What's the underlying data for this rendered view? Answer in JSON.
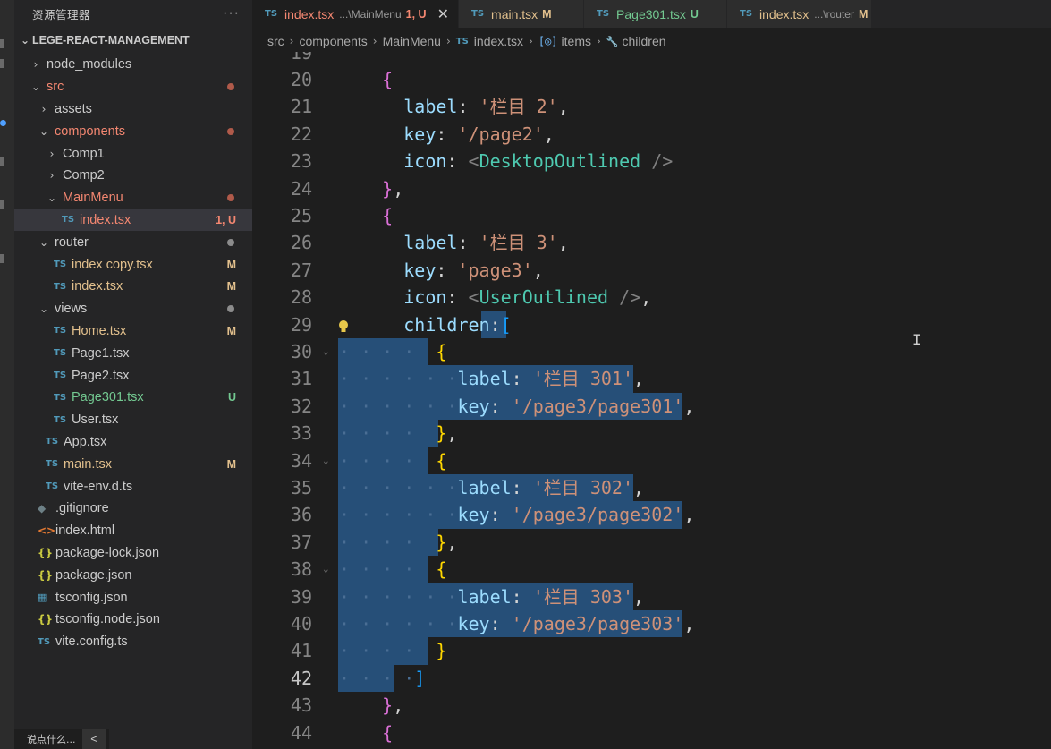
{
  "explorer": {
    "title": "资源管理器",
    "more": "···",
    "project": "LEGE-REACT-MANAGEMENT",
    "items": [
      {
        "label": "node_modules",
        "kind": "folder",
        "depth": 1,
        "expanded": false,
        "color": "default",
        "status": ""
      },
      {
        "label": "src",
        "kind": "folder",
        "depth": 1,
        "expanded": true,
        "color": "err",
        "status": "dot-err"
      },
      {
        "label": "assets",
        "kind": "folder",
        "depth": 2,
        "expanded": false,
        "color": "default",
        "status": ""
      },
      {
        "label": "components",
        "kind": "folder",
        "depth": 2,
        "expanded": true,
        "color": "err",
        "status": "dot-err"
      },
      {
        "label": "Comp1",
        "kind": "folder",
        "depth": 3,
        "expanded": false,
        "color": "default",
        "status": ""
      },
      {
        "label": "Comp2",
        "kind": "folder",
        "depth": 3,
        "expanded": false,
        "color": "default",
        "status": ""
      },
      {
        "label": "MainMenu",
        "kind": "folder",
        "depth": 3,
        "expanded": true,
        "color": "err",
        "status": "dot-err"
      },
      {
        "label": "index.tsx",
        "kind": "ts",
        "depth": 4,
        "color": "err",
        "status": "1, U",
        "selected": true
      },
      {
        "label": "router",
        "kind": "folder",
        "depth": 2,
        "expanded": true,
        "color": "default",
        "status": "dot-gray"
      },
      {
        "label": "index copy.tsx",
        "kind": "ts",
        "depth": 3,
        "color": "mod",
        "status": "M"
      },
      {
        "label": "index.tsx",
        "kind": "ts",
        "depth": 3,
        "color": "mod",
        "status": "M"
      },
      {
        "label": "views",
        "kind": "folder",
        "depth": 2,
        "expanded": true,
        "color": "default",
        "status": "dot-gray"
      },
      {
        "label": "Home.tsx",
        "kind": "ts",
        "depth": 3,
        "color": "mod",
        "status": "M"
      },
      {
        "label": "Page1.tsx",
        "kind": "ts",
        "depth": 3,
        "color": "default",
        "status": ""
      },
      {
        "label": "Page2.tsx",
        "kind": "ts",
        "depth": 3,
        "color": "default",
        "status": ""
      },
      {
        "label": "Page301.tsx",
        "kind": "ts",
        "depth": 3,
        "color": "untr",
        "status": "U"
      },
      {
        "label": "User.tsx",
        "kind": "ts",
        "depth": 3,
        "color": "default",
        "status": ""
      },
      {
        "label": "App.tsx",
        "kind": "ts",
        "depth": 2,
        "color": "default",
        "status": ""
      },
      {
        "label": "main.tsx",
        "kind": "ts",
        "depth": 2,
        "color": "mod",
        "status": "M"
      },
      {
        "label": "vite-env.d.ts",
        "kind": "ts",
        "depth": 2,
        "color": "default",
        "status": ""
      },
      {
        "label": ".gitignore",
        "kind": "git",
        "depth": 1,
        "color": "default",
        "status": ""
      },
      {
        "label": "index.html",
        "kind": "html",
        "depth": 1,
        "color": "default",
        "status": ""
      },
      {
        "label": "package-lock.json",
        "kind": "json",
        "depth": 1,
        "color": "default",
        "status": ""
      },
      {
        "label": "package.json",
        "kind": "json",
        "depth": 1,
        "color": "default",
        "status": ""
      },
      {
        "label": "tsconfig.json",
        "kind": "tsconf",
        "depth": 1,
        "color": "default",
        "status": ""
      },
      {
        "label": "tsconfig.node.json",
        "kind": "json",
        "depth": 1,
        "color": "default",
        "status": ""
      },
      {
        "label": "vite.config.ts",
        "kind": "ts",
        "depth": 1,
        "color": "default",
        "status": ""
      }
    ]
  },
  "statusbar": {
    "comment": "说点什么...",
    "back": "<"
  },
  "tabs": [
    {
      "icon": "TS",
      "name": "index.tsx",
      "desc": "...\\MainMenu",
      "status": "1, U",
      "color": "err",
      "active": true,
      "close": "✕"
    },
    {
      "icon": "TS",
      "name": "main.tsx",
      "desc": "",
      "status": "M",
      "color": "mod",
      "active": false
    },
    {
      "icon": "TS",
      "name": "Page301.tsx",
      "desc": "",
      "status": "U",
      "color": "untr",
      "active": false
    },
    {
      "icon": "TS",
      "name": "index.tsx",
      "desc": "...\\router",
      "status": "M",
      "color": "mod",
      "active": false
    }
  ],
  "breadcrumb": {
    "parts": [
      "src",
      "components",
      "MainMenu",
      "index.tsx",
      "items",
      "children"
    ],
    "ts_icon": "TS",
    "symbol_icon": "[◎]",
    "wrench_icon": "🔧"
  },
  "code": {
    "first_partial": "19",
    "lines": [
      {
        "n": "20",
        "segs": [
          [
            "p",
            "    "
          ],
          [
            "b2",
            "{"
          ]
        ]
      },
      {
        "n": "21",
        "segs": [
          [
            "p",
            "      "
          ],
          [
            "k",
            "label"
          ],
          [
            "p",
            ": "
          ],
          [
            "s",
            "'栏目 2'"
          ],
          [
            "p",
            ","
          ]
        ]
      },
      {
        "n": "22",
        "segs": [
          [
            "p",
            "      "
          ],
          [
            "k",
            "key"
          ],
          [
            "p",
            ": "
          ],
          [
            "s",
            "'/page2'"
          ],
          [
            "p",
            ","
          ]
        ]
      },
      {
        "n": "23",
        "segs": [
          [
            "p",
            "      "
          ],
          [
            "k",
            "icon"
          ],
          [
            "p",
            ": "
          ],
          [
            "tag",
            "<"
          ],
          [
            "cmp",
            "DesktopOutlined"
          ],
          [
            "p",
            " "
          ],
          [
            "tag",
            "/>"
          ]
        ]
      },
      {
        "n": "24",
        "segs": [
          [
            "p",
            "    "
          ],
          [
            "b2",
            "}"
          ],
          [
            "p",
            ","
          ]
        ]
      },
      {
        "n": "25",
        "segs": [
          [
            "p",
            "    "
          ],
          [
            "b2",
            "{"
          ]
        ]
      },
      {
        "n": "26",
        "segs": [
          [
            "p",
            "      "
          ],
          [
            "k",
            "label"
          ],
          [
            "p",
            ": "
          ],
          [
            "s",
            "'栏目 3'"
          ],
          [
            "p",
            ","
          ]
        ]
      },
      {
        "n": "27",
        "segs": [
          [
            "p",
            "      "
          ],
          [
            "k",
            "key"
          ],
          [
            "p",
            ": "
          ],
          [
            "s",
            "'page3'"
          ],
          [
            "p",
            ","
          ]
        ]
      },
      {
        "n": "28",
        "segs": [
          [
            "p",
            "      "
          ],
          [
            "k",
            "icon"
          ],
          [
            "p",
            ": "
          ],
          [
            "tag",
            "<"
          ],
          [
            "cmp",
            "UserOutlined"
          ],
          [
            "p",
            " "
          ],
          [
            "tag",
            "/>"
          ],
          [
            "p",
            ","
          ]
        ]
      },
      {
        "n": "29",
        "segs": [
          [
            "p",
            "      "
          ],
          [
            "k",
            "children"
          ],
          [
            "p",
            ":"
          ],
          [
            "b3",
            "["
          ]
        ]
      },
      {
        "n": "30",
        "segs": [
          [
            "ws",
            "· · · ·"
          ],
          [
            "p",
            "  "
          ],
          [
            "b1",
            "{"
          ]
        ]
      },
      {
        "n": "31",
        "segs": [
          [
            "ws",
            "· · · · · ·"
          ],
          [
            "k",
            "label"
          ],
          [
            "p",
            ": "
          ],
          [
            "s",
            "'栏目 301'"
          ],
          [
            "p",
            ","
          ]
        ]
      },
      {
        "n": "32",
        "segs": [
          [
            "ws",
            "· · · · · ·"
          ],
          [
            "k",
            "key"
          ],
          [
            "p",
            ": "
          ],
          [
            "s",
            "'/page3/page301'"
          ],
          [
            "p",
            ","
          ]
        ]
      },
      {
        "n": "33",
        "segs": [
          [
            "ws",
            "· · · ·"
          ],
          [
            "p",
            "  "
          ],
          [
            "b1",
            "}"
          ],
          [
            "p",
            ","
          ]
        ]
      },
      {
        "n": "34",
        "segs": [
          [
            "ws",
            "· · · ·"
          ],
          [
            "p",
            "  "
          ],
          [
            "b1",
            "{"
          ]
        ]
      },
      {
        "n": "35",
        "segs": [
          [
            "ws",
            "· · · · · ·"
          ],
          [
            "k",
            "label"
          ],
          [
            "p",
            ": "
          ],
          [
            "s",
            "'栏目 302'"
          ],
          [
            "p",
            ","
          ]
        ]
      },
      {
        "n": "36",
        "segs": [
          [
            "ws",
            "· · · · · ·"
          ],
          [
            "k",
            "key"
          ],
          [
            "p",
            ": "
          ],
          [
            "s",
            "'/page3/page302'"
          ],
          [
            "p",
            ","
          ]
        ]
      },
      {
        "n": "37",
        "segs": [
          [
            "ws",
            "· · · ·"
          ],
          [
            "p",
            "  "
          ],
          [
            "b1",
            "}"
          ],
          [
            "p",
            ","
          ]
        ]
      },
      {
        "n": "38",
        "segs": [
          [
            "ws",
            "· · · ·"
          ],
          [
            "p",
            "  "
          ],
          [
            "b1",
            "{"
          ]
        ]
      },
      {
        "n": "39",
        "segs": [
          [
            "ws",
            "· · · · · ·"
          ],
          [
            "k",
            "label"
          ],
          [
            "p",
            ": "
          ],
          [
            "s",
            "'栏目 303'"
          ],
          [
            "p",
            ","
          ]
        ]
      },
      {
        "n": "40",
        "segs": [
          [
            "ws",
            "· · · · · ·"
          ],
          [
            "k",
            "key"
          ],
          [
            "p",
            ": "
          ],
          [
            "s",
            "'/page3/page303'"
          ],
          [
            "p",
            ","
          ]
        ]
      },
      {
        "n": "41",
        "segs": [
          [
            "ws",
            "· · · ·"
          ],
          [
            "p",
            "  "
          ],
          [
            "b1",
            "}"
          ]
        ]
      },
      {
        "n": "42",
        "segs": [
          [
            "ws",
            "· · · ·"
          ],
          [
            "b3",
            "]"
          ]
        ]
      },
      {
        "n": "43",
        "segs": [
          [
            "p",
            "    "
          ],
          [
            "b2",
            "}"
          ],
          [
            "p",
            ","
          ]
        ]
      },
      {
        "n": "44",
        "segs": [
          [
            "p",
            "    "
          ],
          [
            "b2",
            "{"
          ]
        ]
      }
    ]
  },
  "colors": {
    "accent": "#264f78",
    "modified": "#e2c08d",
    "error": "#f48771",
    "untracked": "#73c991"
  }
}
